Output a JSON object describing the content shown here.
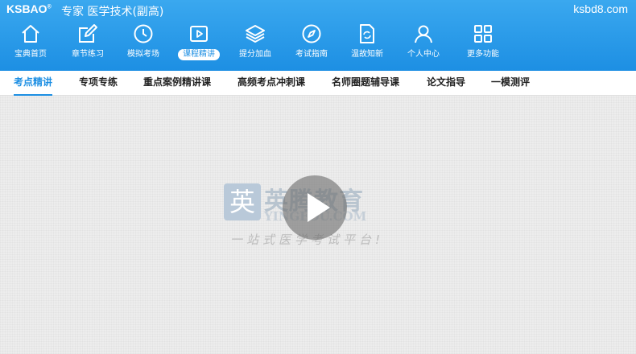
{
  "header": {
    "brand": "KSBAO",
    "brand_mark": "®",
    "app_title": "专家 医学技术(副高)",
    "site": "ksbd8.com"
  },
  "nav": [
    {
      "label": "宝典首页",
      "icon": "home-icon"
    },
    {
      "label": "章节练习",
      "icon": "edit-icon"
    },
    {
      "label": "模拟考场",
      "icon": "clock-icon"
    },
    {
      "label": "课程精讲",
      "icon": "play-icon",
      "active": true
    },
    {
      "label": "提分加血",
      "icon": "layers-icon"
    },
    {
      "label": "考试指南",
      "icon": "compass-icon"
    },
    {
      "label": "温故知新",
      "icon": "refresh-doc-icon"
    },
    {
      "label": "个人中心",
      "icon": "user-icon"
    },
    {
      "label": "更多功能",
      "icon": "grid-icon"
    }
  ],
  "tabs": [
    "考点精讲",
    "专项专练",
    "重点案例精讲课",
    "高频考点冲刺课",
    "名师圈题辅导课",
    "论文指导",
    "一模测评"
  ],
  "watermark": {
    "logo_char": "英",
    "name_cn": "英腾教育",
    "name_en": "YINGEDU.COM",
    "slogan": "一站式医学考试平台!"
  },
  "colors": {
    "primary": "#1d8fe3",
    "header_light": "#3aa8ef"
  }
}
